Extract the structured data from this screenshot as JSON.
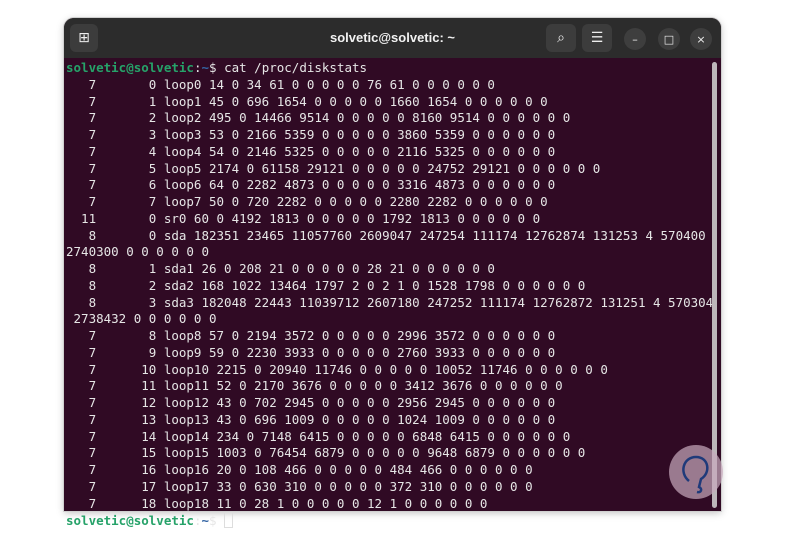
{
  "window": {
    "title": "solvetic@solvetic: ~"
  },
  "prompt": {
    "user": "solvetic@solvetic",
    "sep": ":",
    "path": "~",
    "symbol": "$ ",
    "command": "cat /proc/diskstats"
  },
  "output": [
    "   7       0 loop0 14 0 34 61 0 0 0 0 0 76 61 0 0 0 0 0 0",
    "   7       1 loop1 45 0 696 1654 0 0 0 0 0 1660 1654 0 0 0 0 0 0",
    "   7       2 loop2 495 0 14466 9514 0 0 0 0 0 8160 9514 0 0 0 0 0 0",
    "   7       3 loop3 53 0 2166 5359 0 0 0 0 0 3860 5359 0 0 0 0 0 0",
    "   7       4 loop4 54 0 2146 5325 0 0 0 0 0 2116 5325 0 0 0 0 0 0",
    "   7       5 loop5 2174 0 61158 29121 0 0 0 0 0 24752 29121 0 0 0 0 0 0",
    "   7       6 loop6 64 0 2282 4873 0 0 0 0 0 3316 4873 0 0 0 0 0 0",
    "   7       7 loop7 50 0 720 2282 0 0 0 0 0 2280 2282 0 0 0 0 0 0",
    "  11       0 sr0 60 0 4192 1813 0 0 0 0 0 1792 1813 0 0 0 0 0 0",
    "   8       0 sda 182351 23465 11057760 2609047 247254 111174 12762874 131253 4 570400",
    "2740300 0 0 0 0 0 0",
    "   8       1 sda1 26 0 208 21 0 0 0 0 0 28 21 0 0 0 0 0 0",
    "   8       2 sda2 168 1022 13464 1797 2 0 2 1 0 1528 1798 0 0 0 0 0 0",
    "   8       3 sda3 182048 22443 11039712 2607180 247252 111174 12762872 131251 4 570304",
    " 2738432 0 0 0 0 0 0",
    "   7       8 loop8 57 0 2194 3572 0 0 0 0 0 2996 3572 0 0 0 0 0 0",
    "   7       9 loop9 59 0 2230 3933 0 0 0 0 0 2760 3933 0 0 0 0 0 0",
    "   7      10 loop10 2215 0 20940 11746 0 0 0 0 0 10052 11746 0 0 0 0 0 0",
    "   7      11 loop11 52 0 2170 3676 0 0 0 0 0 3412 3676 0 0 0 0 0 0",
    "   7      12 loop12 43 0 702 2945 0 0 0 0 0 2956 2945 0 0 0 0 0 0",
    "   7      13 loop13 43 0 696 1009 0 0 0 0 0 1024 1009 0 0 0 0 0 0",
    "   7      14 loop14 234 0 7148 6415 0 0 0 0 0 6848 6415 0 0 0 0 0 0",
    "   7      15 loop15 1003 0 76454 6879 0 0 0 0 0 9648 6879 0 0 0 0 0 0",
    "   7      16 loop16 20 0 108 466 0 0 0 0 0 484 466 0 0 0 0 0 0",
    "   7      17 loop17 33 0 630 310 0 0 0 0 0 372 310 0 0 0 0 0 0",
    "   7      18 loop18 11 0 28 1 0 0 0 0 0 12 1 0 0 0 0 0 0"
  ],
  "icons": {
    "new_tab": "⊞",
    "search": "⌕",
    "menu": "☰",
    "minimize": "–",
    "maximize": "□",
    "close": "×"
  }
}
